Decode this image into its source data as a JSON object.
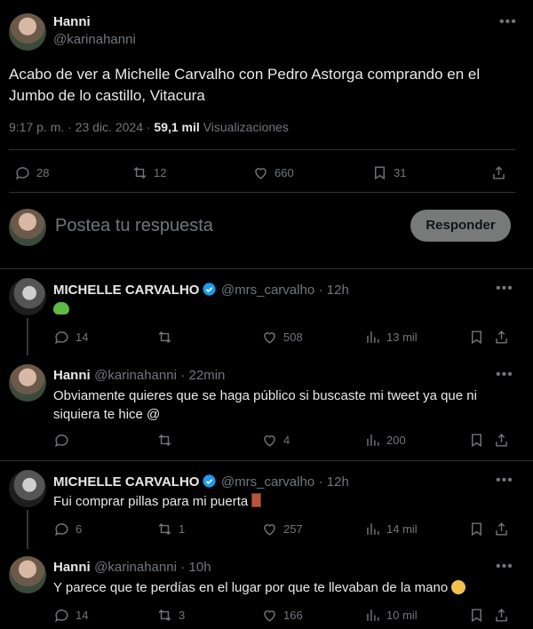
{
  "main_tweet": {
    "author_name": "Hanni",
    "author_handle": "@karinahanni",
    "text": "Acabo de ver a Michelle Carvalho con Pedro Astorga comprando en el Jumbo de lo castillo, Vitacura",
    "timestamp": "9:17 p. m. · 23 dic. 2024 ·",
    "views_count": "59,1 mil",
    "views_label": "Visualizaciones",
    "replies": "28",
    "retweets": "12",
    "likes": "660",
    "bookmarks": "31"
  },
  "reply_box": {
    "placeholder": "Postea tu respuesta",
    "button_label": "Responder"
  },
  "replies": [
    {
      "author_name": "MICHELLE CARVALHO",
      "author_handle": "@mrs_carvalho",
      "time": "· 12h",
      "text": "",
      "replies": "14",
      "retweets": "",
      "likes": "508",
      "views": "13 mil"
    },
    {
      "author_name": "Hanni",
      "author_handle": "@karinahanni",
      "time": "· 22min",
      "text": "Obviamente quieres que se haga público si buscaste mi tweet ya que ni siquiera te hice @",
      "replies": "",
      "retweets": "",
      "likes": "4",
      "views": "200"
    },
    {
      "author_name": "MICHELLE CARVALHO",
      "author_handle": "@mrs_carvalho",
      "time": "· 12h",
      "text": "Fui comprar pillas para mi puerta",
      "replies": "6",
      "retweets": "1",
      "likes": "257",
      "views": "14 mil"
    },
    {
      "author_name": "Hanni",
      "author_handle": "@karinahanni",
      "time": "· 10h",
      "text": "Y parece que te perdías en el lugar por que te llevaban de la mano",
      "replies": "14",
      "retweets": "3",
      "likes": "166",
      "views": "10 mil"
    }
  ],
  "colors": {
    "background": "#000000",
    "text": "#e7e9ea",
    "muted": "#71767b",
    "divider": "#2f3336",
    "verified": "#1d9bf0",
    "button_bg": "#787a7a"
  }
}
